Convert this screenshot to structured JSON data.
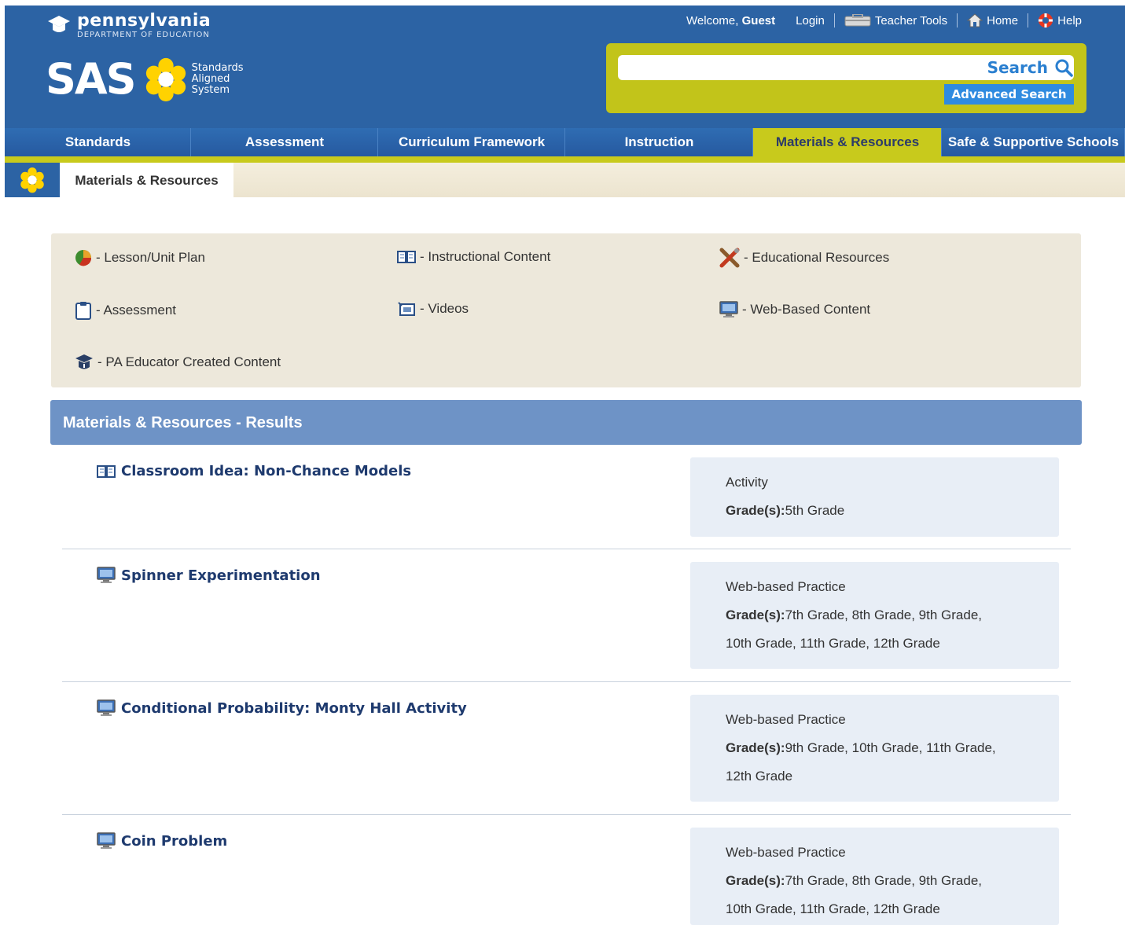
{
  "header": {
    "org_name": "pennsylvania",
    "org_sub": "DEPARTMENT OF EDUCATION",
    "sas_word": "SAS",
    "sas_tag": [
      "Standards",
      "Aligned",
      "System"
    ],
    "welcome_prefix": "Welcome,",
    "welcome_user": "Guest",
    "links": {
      "login": "Login",
      "teacher_tools": "Teacher Tools",
      "home": "Home",
      "help": "Help"
    },
    "search": {
      "value": "",
      "placeholder": "",
      "button": "Search",
      "advanced": "Advanced Search"
    }
  },
  "nav": {
    "items": [
      "Standards",
      "Assessment",
      "Curriculum Framework",
      "Instruction",
      "Materials & Resources",
      "Safe & Supportive Schools"
    ],
    "active": "Materials & Resources"
  },
  "subnav": {
    "tab": "Materials & Resources"
  },
  "legend": {
    "items": [
      {
        "icon": "pie-chart-icon",
        "label": "- Lesson/Unit Plan"
      },
      {
        "icon": "book-icon",
        "label": "- Instructional Content"
      },
      {
        "icon": "tools-icon",
        "label": "- Educational Resources"
      },
      {
        "icon": "clipboard-icon",
        "label": "- Assessment"
      },
      {
        "icon": "video-icon",
        "label": "- Videos"
      },
      {
        "icon": "monitor-icon",
        "label": "- Web-Based Content"
      },
      {
        "icon": "educator-cap-icon",
        "label": "- PA Educator Created Content"
      }
    ]
  },
  "results": {
    "heading": "Materials & Resources - Results",
    "grade_label": "Grade(s):",
    "items": [
      {
        "icon": "book-icon",
        "title": "Classroom Idea: Non-Chance Models",
        "type": "Activity",
        "grades_line1": "5th Grade",
        "grades_line2": ""
      },
      {
        "icon": "monitor-icon",
        "title": "Spinner Experimentation",
        "type": "Web-based Practice",
        "grades_line1": "7th Grade, 8th Grade, 9th Grade,",
        "grades_line2": "10th Grade, 11th Grade, 12th Grade"
      },
      {
        "icon": "monitor-icon",
        "title": "Conditional Probability: Monty Hall Activity",
        "type": "Web-based Practice",
        "grades_line1": "9th Grade, 10th Grade, 11th Grade,",
        "grades_line2": "12th Grade"
      },
      {
        "icon": "monitor-icon",
        "title": "Coin Problem",
        "type": "Web-based Practice",
        "grades_line1": "7th Grade, 8th Grade, 9th Grade,",
        "grades_line2": "10th Grade, 11th Grade, 12th Grade"
      }
    ]
  },
  "colors": {
    "header_blue": "#2c63a4",
    "accent_yellow": "#c8ca1c",
    "results_bar": "#6e93c6",
    "legend_bg": "#ede8db",
    "meta_bg": "#e8eef6"
  }
}
